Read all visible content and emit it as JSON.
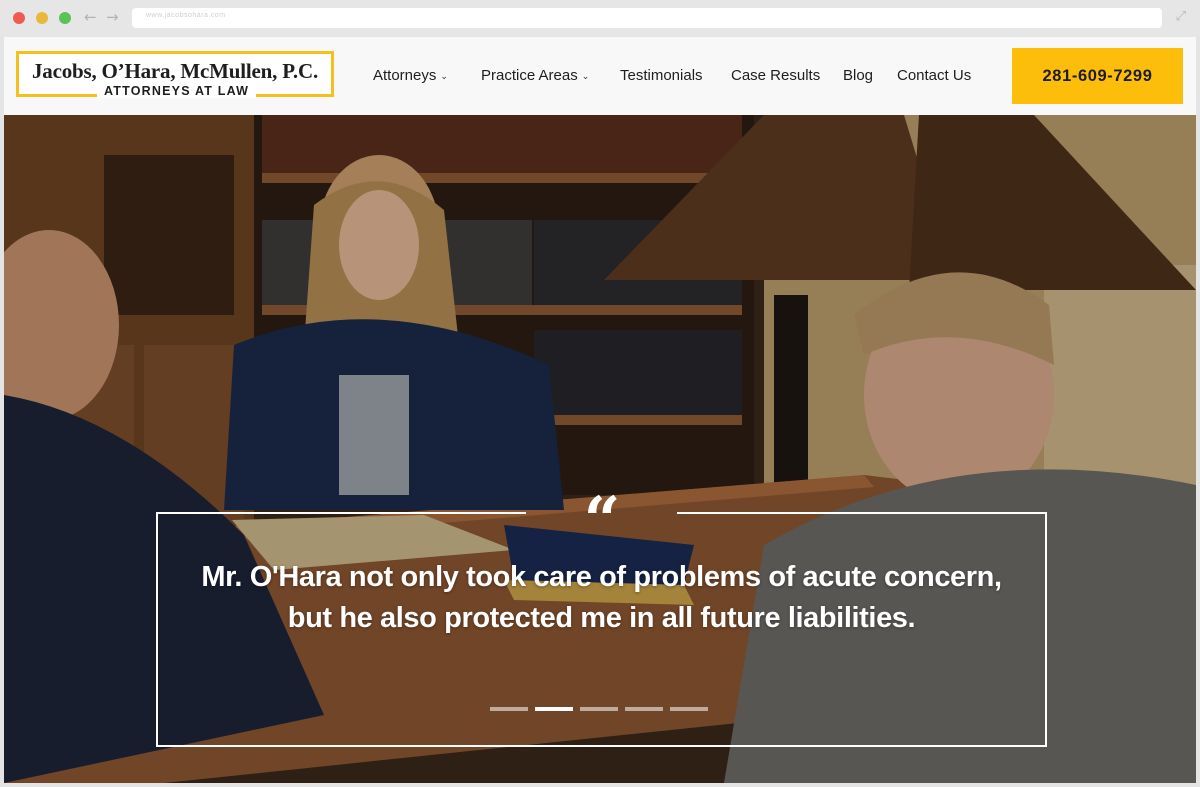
{
  "browser": {
    "url": "www.jacobsohara.com"
  },
  "header": {
    "logo_name": "Jacobs, O’Hara, McMullen, P.C.",
    "logo_tagline": "ATTORNEYS AT LAW",
    "menu": [
      {
        "label": "Attorneys",
        "has_dropdown": true
      },
      {
        "label": "Practice Areas",
        "has_dropdown": true
      },
      {
        "label": "Testimonials",
        "has_dropdown": false
      },
      {
        "label": "Case Results",
        "has_dropdown": false
      },
      {
        "label": "Blog",
        "has_dropdown": false
      },
      {
        "label": "Contact Us",
        "has_dropdown": false
      }
    ],
    "phone": "281-609-7299"
  },
  "hero": {
    "quote_mark": "“",
    "quote": "Mr. O'Hara not only took care of problems of acute concern, but he also protected me in all future liabilities.",
    "slides_total": 5,
    "active_slide": 2
  },
  "colors": {
    "accent": "#fcbe0b",
    "logo_border": "#f5c01d",
    "header_bg": "#f8f8f8",
    "text_dark": "#1e1e1e"
  },
  "icons": {
    "back": "arrow-left",
    "forward": "arrow-right",
    "expand": "diagonal-expand",
    "dropdown": "chevron-down",
    "quote": "quotation-mark"
  }
}
